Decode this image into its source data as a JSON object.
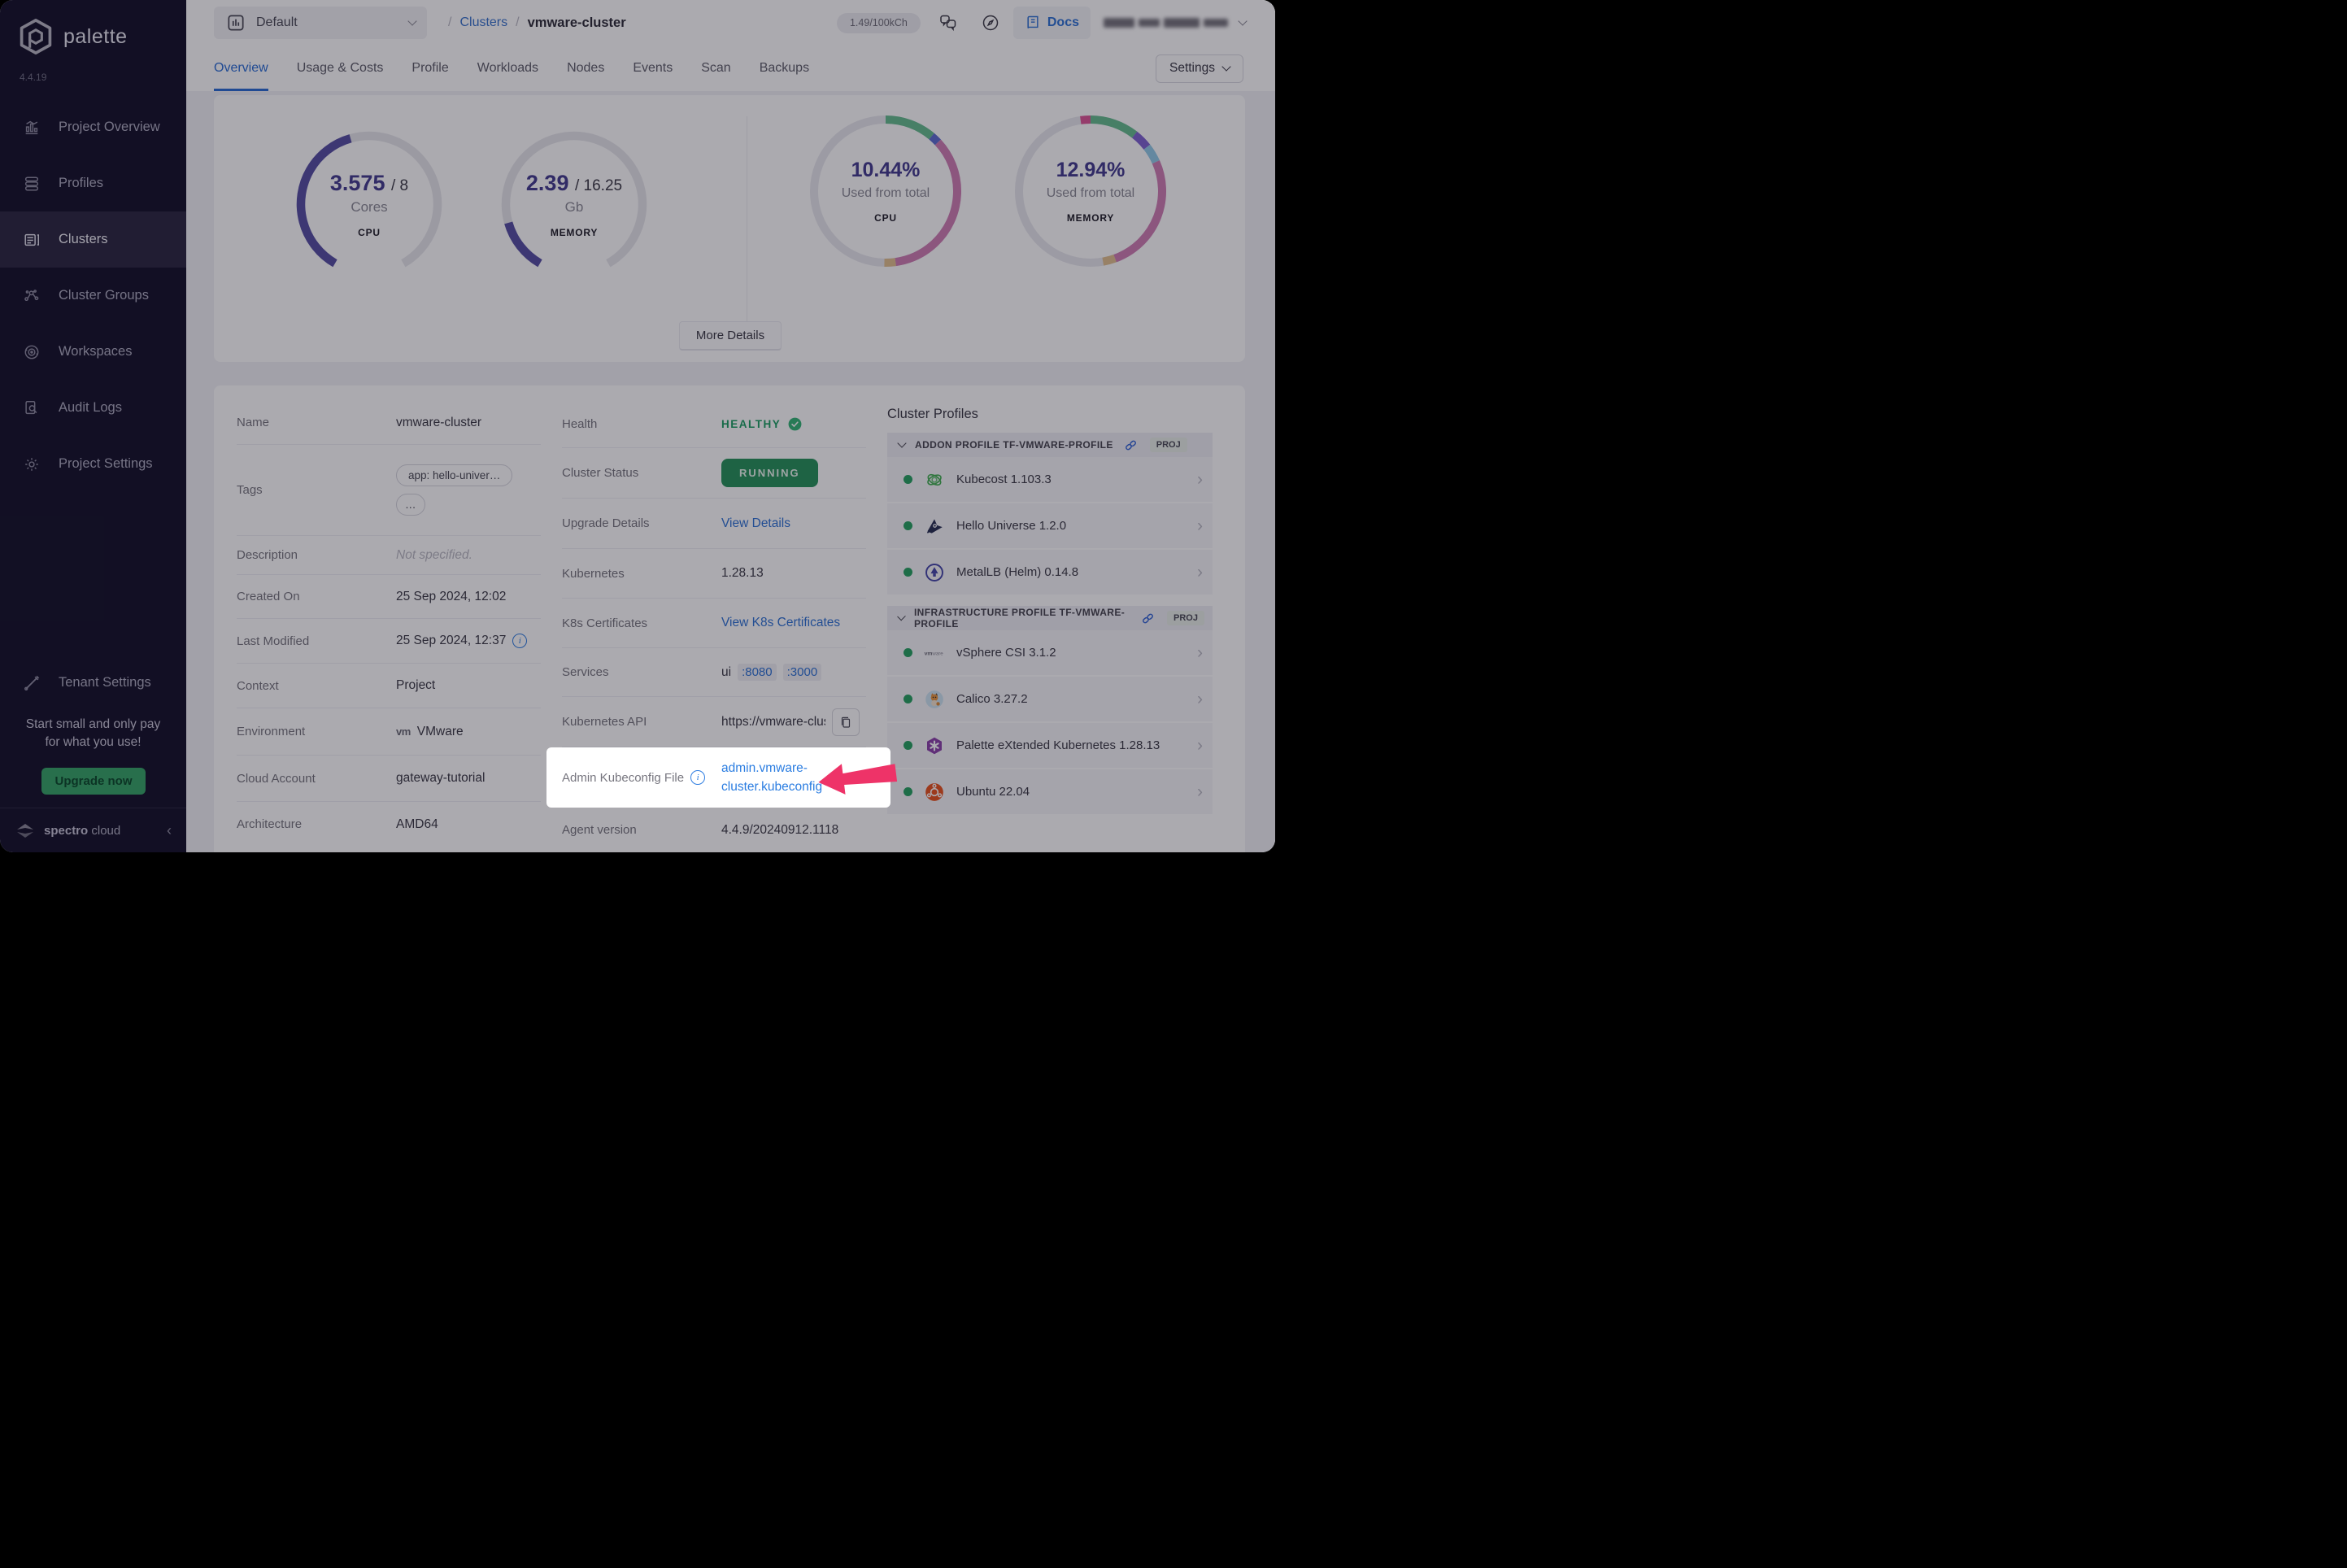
{
  "app": {
    "brand": "palette",
    "version": "4.4.19"
  },
  "sidebar": {
    "items": [
      {
        "icon": "project-overview-icon",
        "label": "Project Overview",
        "active": false
      },
      {
        "icon": "profiles-icon",
        "label": "Profiles",
        "active": false
      },
      {
        "icon": "clusters-icon",
        "label": "Clusters",
        "active": true
      },
      {
        "icon": "cluster-groups-icon",
        "label": "Cluster Groups",
        "active": false
      },
      {
        "icon": "workspaces-icon",
        "label": "Workspaces",
        "active": false
      },
      {
        "icon": "audit-logs-icon",
        "label": "Audit Logs",
        "active": false
      },
      {
        "icon": "project-settings-icon",
        "label": "Project Settings",
        "active": false
      }
    ],
    "tenant_label": "Tenant Settings",
    "promo_line1": "Start small and only pay",
    "promo_line2": "for what you use!",
    "upgrade_label": "Upgrade now",
    "footer_brand_bold": "spectro",
    "footer_brand_light": "cloud"
  },
  "topbar": {
    "project_selector": "Default",
    "breadcrumb_sep": "/",
    "breadcrumb_link": "Clusters",
    "breadcrumb_current": "vmware-cluster",
    "credits": "1.49/100kCh",
    "docs_label": "Docs"
  },
  "tabs": {
    "items": [
      "Overview",
      "Usage & Costs",
      "Profile",
      "Workloads",
      "Nodes",
      "Events",
      "Scan",
      "Backups"
    ],
    "active": "Overview",
    "settings_label": "Settings"
  },
  "chart_data": [
    {
      "type": "gauge",
      "title": "CPU",
      "value": 3.575,
      "max": 8,
      "value_label": "3.575",
      "total_label": "/ 8",
      "unit": "Cores",
      "metric": "CPU",
      "fraction": 0.447,
      "fill_color": "#564fa4",
      "track_color": "#e7e7ec"
    },
    {
      "type": "gauge",
      "title": "MEMORY",
      "value": 2.39,
      "max": 16.25,
      "value_label": "2.39",
      "total_label": "/ 16.25",
      "unit": "Gb",
      "metric": "MEMORY",
      "fraction": 0.147,
      "fill_color": "#564fa4",
      "track_color": "#e7e7ec"
    },
    {
      "type": "donut",
      "title": "CPU",
      "percent_label": "10.44%",
      "caption": "Used from total",
      "metric": "CPU",
      "track_color": "#e8e8ee",
      "segments": [
        {
          "color": "#66bd90",
          "start": 0,
          "sweep": 40
        },
        {
          "color": "#5e6ed2",
          "start": 40,
          "sweep": 7
        },
        {
          "color": "#cf7fb4",
          "start": 47,
          "sweep": 125
        },
        {
          "color": "#e2c08f",
          "start": 172,
          "sweep": 9
        }
      ]
    },
    {
      "type": "donut",
      "title": "MEMORY",
      "percent_label": "12.94%",
      "caption": "Used from total",
      "metric": "MEMORY",
      "track_color": "#e8e8ee",
      "segments": [
        {
          "color": "#dd5797",
          "start": 352,
          "sweep": 8
        },
        {
          "color": "#66bd90",
          "start": 0,
          "sweep": 38
        },
        {
          "color": "#7f63d2",
          "start": 38,
          "sweep": 14
        },
        {
          "color": "#93cbe8",
          "start": 52,
          "sweep": 14
        },
        {
          "color": "#cf7fb4",
          "start": 66,
          "sweep": 94
        },
        {
          "color": "#e2c08f",
          "start": 160,
          "sweep": 10
        }
      ]
    }
  ],
  "usage_card": {
    "more_details_label": "More Details"
  },
  "details": {
    "left_rows": [
      {
        "label": "Name",
        "type": "text",
        "value": "vmware-cluster",
        "h": 54
      },
      {
        "label": "Tags",
        "type": "tags",
        "tags": [
          "app: hello-univer…",
          "…"
        ],
        "h": 112
      },
      {
        "label": "Description",
        "type": "muted",
        "value": "Not specified.",
        "h": 48
      },
      {
        "label": "Created On",
        "type": "text",
        "value": "25 Sep 2024, 12:02",
        "h": 54
      },
      {
        "label": "Last Modified",
        "type": "text_info",
        "value": "25 Sep 2024, 12:37",
        "h": 55
      },
      {
        "label": "Context",
        "type": "text",
        "value": "Project",
        "h": 55
      },
      {
        "label": "Environment",
        "type": "env",
        "logo": "vm",
        "value": "VMware",
        "h": 58
      },
      {
        "label": "Cloud Account",
        "type": "text",
        "value": "gateway-tutorial",
        "h": 57
      },
      {
        "label": "Architecture",
        "type": "text",
        "value": "AMD64",
        "h": 55
      }
    ],
    "middle_rows": [
      {
        "label": "Health",
        "type": "health",
        "value": "HEALTHY",
        "h": 58
      },
      {
        "label": "Cluster Status",
        "type": "badge",
        "value": "RUNNING",
        "h": 62
      },
      {
        "label": "Upgrade Details",
        "type": "link",
        "value": "View Details",
        "h": 62
      },
      {
        "label": "Kubernetes",
        "type": "text",
        "value": "1.28.13",
        "h": 61
      },
      {
        "label": "K8s Certificates",
        "type": "link",
        "value": "View K8s Certificates",
        "h": 61
      },
      {
        "label": "Services",
        "type": "services",
        "prefix": "ui",
        "ports": [
          ":8080",
          ":3000"
        ],
        "h": 60
      },
      {
        "label": "Kubernetes API",
        "type": "api",
        "value": "https://vmware-clust…",
        "h": 62
      },
      {
        "label": "Admin Kubeconfig File",
        "type": "spotlight",
        "link_line1": "admin.vmware-",
        "link_line2": "cluster.kubeconfig",
        "h": 74
      },
      {
        "label": "Agent version",
        "type": "text",
        "value": "4.4.9/20240912.1118",
        "h": 55
      }
    ]
  },
  "cluster_profiles": {
    "title": "Cluster Profiles",
    "groups": [
      {
        "name": "ADDON PROFILE TF-VMWARE-PROFILE",
        "badge": "PROJ",
        "items": [
          {
            "icon": "kubecost-icon",
            "name": "Kubecost 1.103.3"
          },
          {
            "icon": "hello-universe-icon",
            "name": "Hello Universe 1.2.0"
          },
          {
            "icon": "metallb-icon",
            "name": "MetalLB (Helm) 0.14.8"
          }
        ]
      },
      {
        "name": "INFRASTRUCTURE PROFILE TF-VMWARE-PROFILE",
        "badge": "PROJ",
        "items": [
          {
            "icon": "vmware-icon",
            "name": "vSphere CSI 3.1.2"
          },
          {
            "icon": "calico-icon",
            "name": "Calico 3.27.2"
          },
          {
            "icon": "pxk-icon",
            "name": "Palette eXtended Kubernetes 1.28.13"
          },
          {
            "icon": "ubuntu-icon",
            "name": "Ubuntu 22.04"
          }
        ]
      }
    ]
  }
}
